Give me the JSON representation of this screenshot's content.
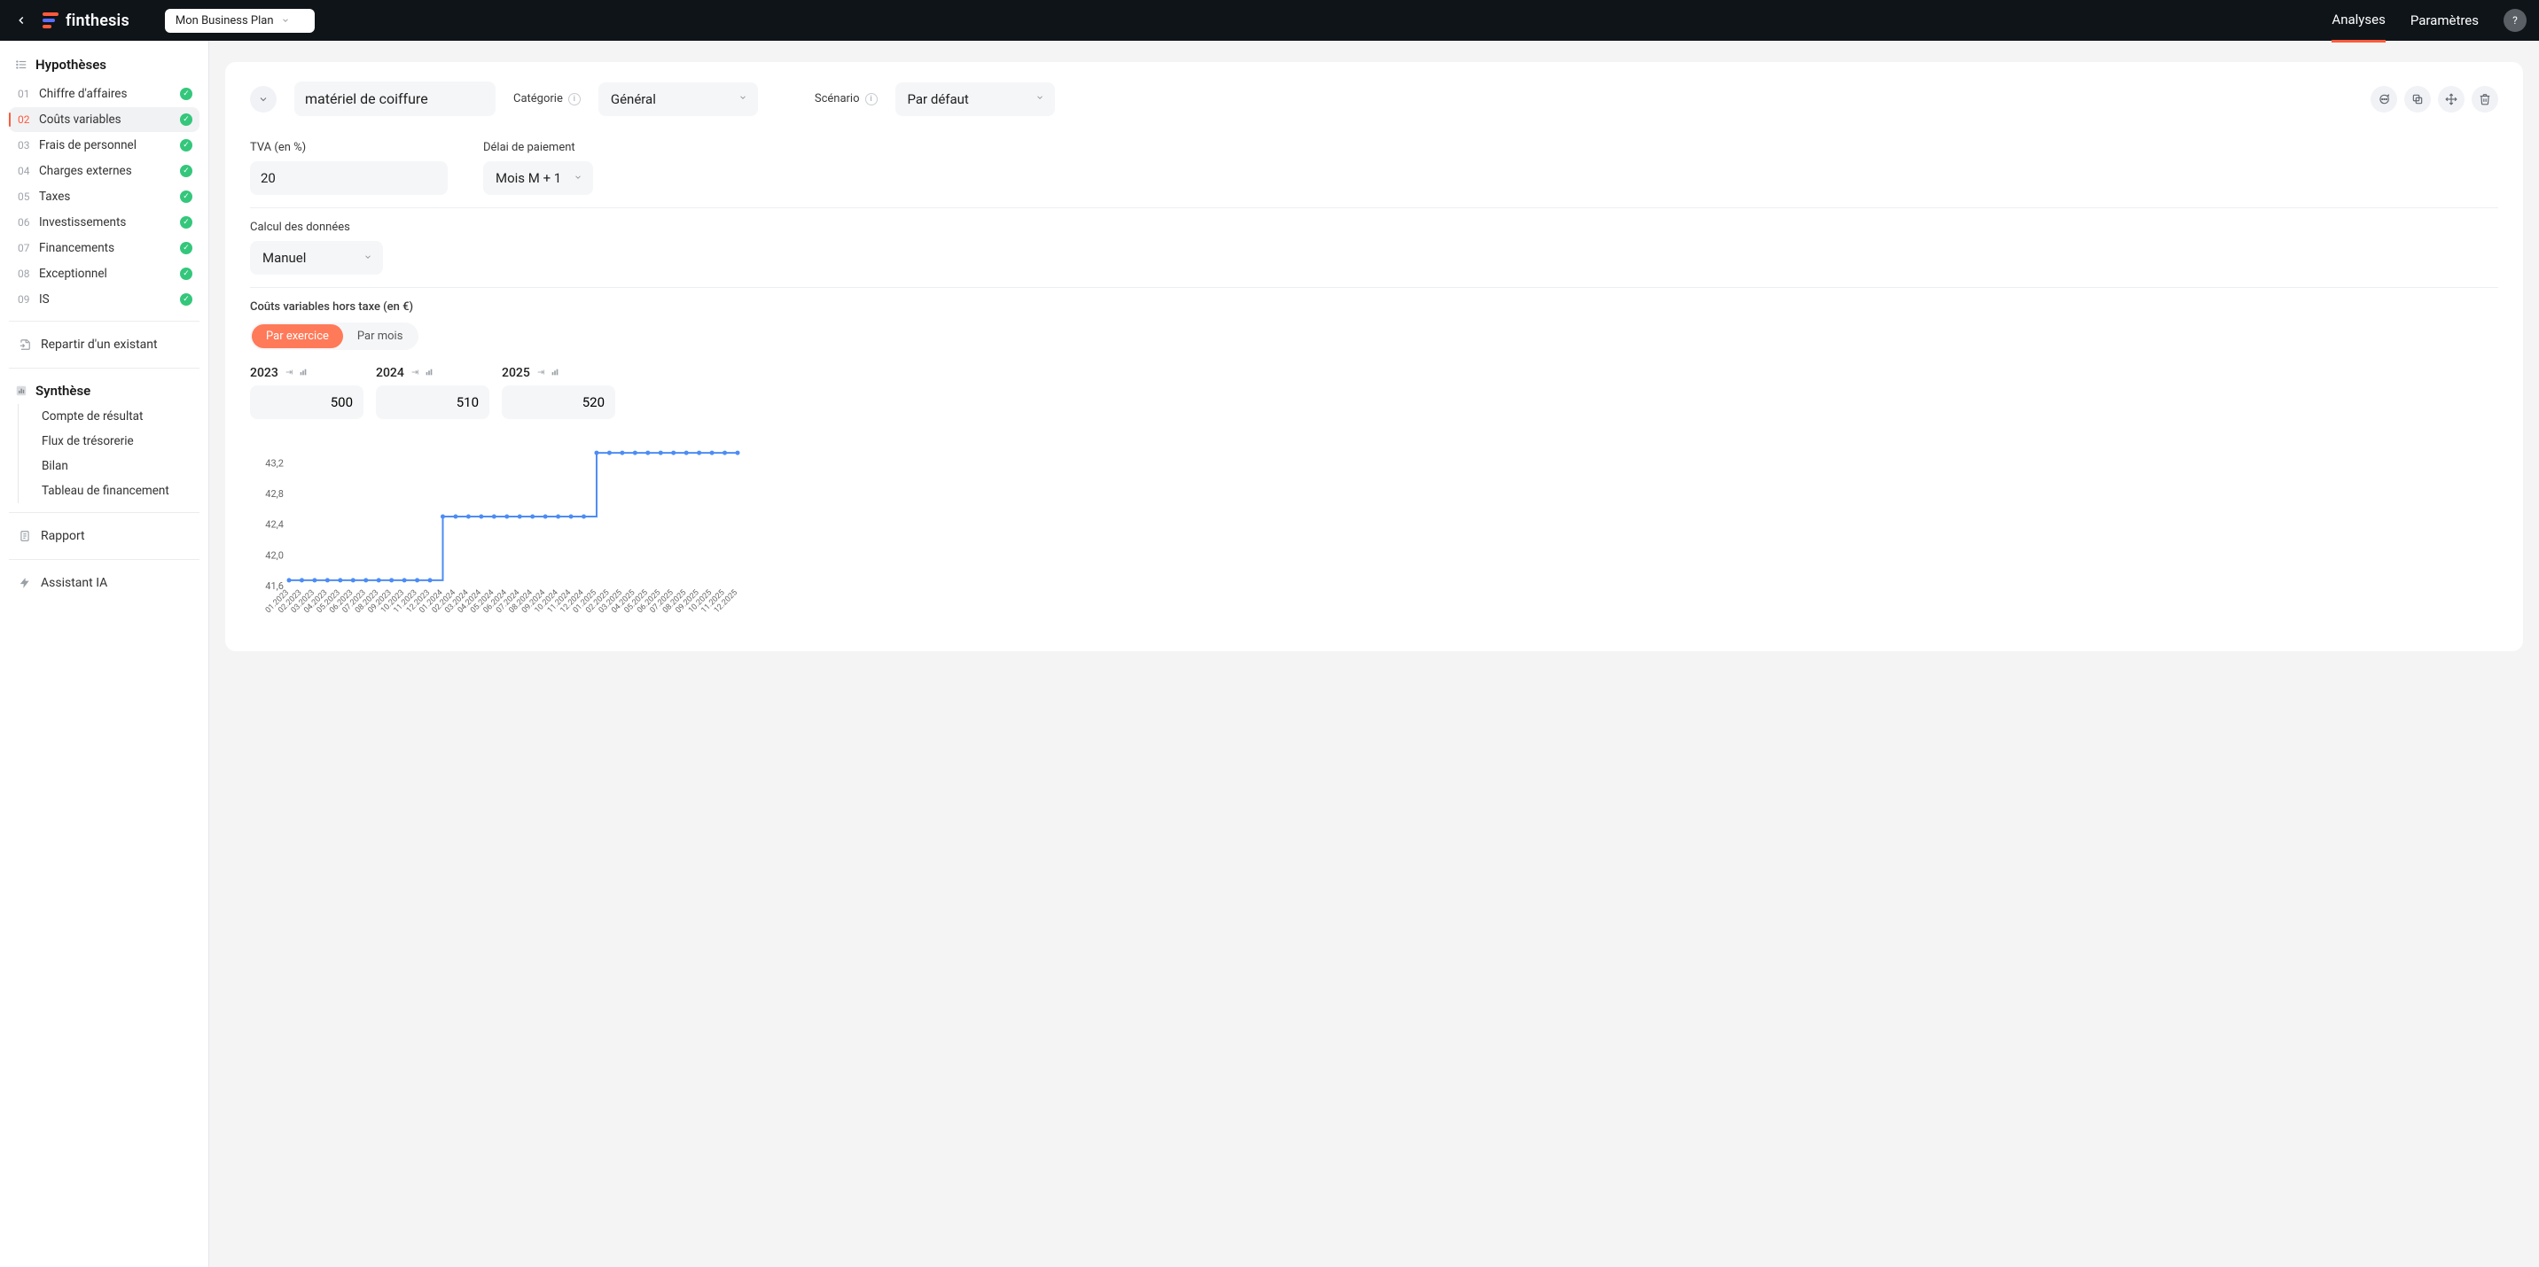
{
  "app_name": "finthesis",
  "top": {
    "plan_selector": "Mon Business Plan",
    "links": {
      "analyses": "Analyses",
      "parametres": "Paramètres"
    },
    "avatar_glyph": "?"
  },
  "sidebar": {
    "hypotheses_title": "Hypothèses",
    "items": [
      {
        "num": "01",
        "label": "Chiffre d'affaires",
        "done": true,
        "active": false
      },
      {
        "num": "02",
        "label": "Coûts variables",
        "done": true,
        "active": true
      },
      {
        "num": "03",
        "label": "Frais de personnel",
        "done": true,
        "active": false
      },
      {
        "num": "04",
        "label": "Charges externes",
        "done": true,
        "active": false
      },
      {
        "num": "05",
        "label": "Taxes",
        "done": true,
        "active": false
      },
      {
        "num": "06",
        "label": "Investissements",
        "done": true,
        "active": false
      },
      {
        "num": "07",
        "label": "Financements",
        "done": true,
        "active": false
      },
      {
        "num": "08",
        "label": "Exceptionnel",
        "done": true,
        "active": false
      },
      {
        "num": "09",
        "label": "IS",
        "done": true,
        "active": false
      }
    ],
    "repartir": "Repartir d'un existant",
    "synthese_title": "Synthèse",
    "synthese_items": [
      "Compte de résultat",
      "Flux de trésorerie",
      "Bilan",
      "Tableau de financement"
    ],
    "rapport": "Rapport",
    "assistant": "Assistant IA"
  },
  "panel": {
    "name_value": "matériel de coiffure",
    "categorie_label": "Catégorie",
    "categorie_value": "Général",
    "scenario_label": "Scénario",
    "scenario_value": "Par défaut",
    "tva_label": "TVA (en %)",
    "tva_value": "20",
    "delai_label": "Délai de paiement",
    "delai_value": "Mois M + 1",
    "calcul_label": "Calcul des données",
    "calcul_value": "Manuel",
    "costs_title": "Coûts variables hors taxe (en €)",
    "toggle": {
      "exercice": "Par exercice",
      "mois": "Par mois"
    },
    "years": [
      {
        "year": "2023",
        "value": "500"
      },
      {
        "year": "2024",
        "value": "510"
      },
      {
        "year": "2025",
        "value": "520"
      }
    ]
  },
  "chart_data": {
    "type": "line",
    "title": "",
    "xlabel": "",
    "ylabel": "",
    "ylim": [
      41.6,
      43.4
    ],
    "y_ticks": [
      41.6,
      42.0,
      42.4,
      42.8,
      43.2
    ],
    "x": [
      "01.2023",
      "02.2023",
      "03.2023",
      "04.2023",
      "05.2023",
      "06.2023",
      "07.2023",
      "08.2023",
      "09.2023",
      "10.2023",
      "11.2023",
      "12.2023",
      "01.2024",
      "02.2024",
      "03.2024",
      "04.2024",
      "05.2024",
      "06.2024",
      "07.2024",
      "08.2024",
      "09.2024",
      "10.2024",
      "11.2024",
      "12.2024",
      "01.2025",
      "02.2025",
      "03.2025",
      "04.2025",
      "05.2025",
      "06.2025",
      "07.2025",
      "08.2025",
      "09.2025",
      "10.2025",
      "11.2025",
      "12.2025"
    ],
    "values": [
      41.67,
      41.67,
      41.67,
      41.67,
      41.67,
      41.67,
      41.67,
      41.67,
      41.67,
      41.67,
      41.67,
      41.67,
      42.5,
      42.5,
      42.5,
      42.5,
      42.5,
      42.5,
      42.5,
      42.5,
      42.5,
      42.5,
      42.5,
      42.5,
      43.33,
      43.33,
      43.33,
      43.33,
      43.33,
      43.33,
      43.33,
      43.33,
      43.33,
      43.33,
      43.33,
      43.33
    ]
  }
}
